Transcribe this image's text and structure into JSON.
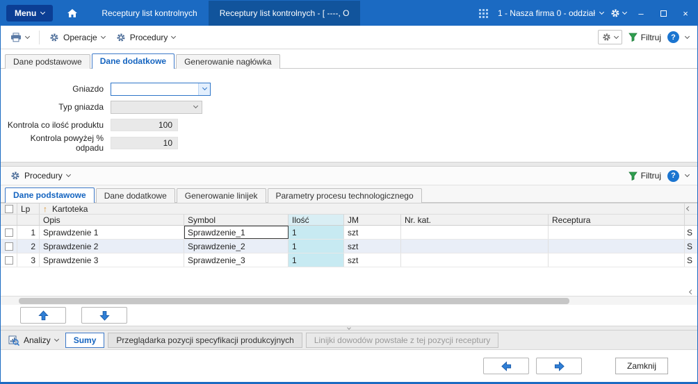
{
  "colors": {
    "titlebar_blue": "#1b6ac2",
    "menu_navy": "#0b3e94",
    "accent_blue": "#1464c0",
    "active_tab_border": "#3c78c8",
    "ilosc_cyan": "#c7eaf2",
    "row_alt_blue": "#e9eef7",
    "filter_green": "#2f9e4f"
  },
  "titlebar": {
    "menu_label": "Menu",
    "tab_background": "Receptury list kontrolnych",
    "tab_active": "Receptury list kontrolnych - [ ----, O",
    "company_selector": "1 - Nasza firma 0 - oddział",
    "minimize_glyph": "–",
    "close_glyph": "×"
  },
  "toolbar": {
    "operacje_label": "Operacje",
    "procedury_label": "Procedury",
    "filtruj_label": "Filtruj",
    "help_glyph": "?"
  },
  "upper_tabs": [
    {
      "label": "Dane podstawowe"
    },
    {
      "label": "Dane dodatkowe"
    },
    {
      "label": "Generowanie nagłówka"
    }
  ],
  "form": {
    "gniazdo_label": "Gniazdo",
    "gniazdo_value": "",
    "typ_gniazda_label": "Typ gniazda",
    "typ_gniazda_value": "",
    "kontrola_ilosc_label": "Kontrola co ilość produktu",
    "kontrola_ilosc_value": "100",
    "kontrola_odpad_label": "Kontrola powyżej % odpadu",
    "kontrola_odpad_value": "10"
  },
  "procedures_bar": {
    "label": "Procedury",
    "filtruj_label": "Filtruj",
    "help_glyph": "?"
  },
  "lower_tabs": [
    {
      "label": "Dane podstawowe"
    },
    {
      "label": "Dane dodatkowe"
    },
    {
      "label": "Generowanie linijek"
    },
    {
      "label": "Parametry procesu technologicznego"
    }
  ],
  "grid": {
    "sort_icon": "↑",
    "band": {
      "lp": "Lp",
      "group": "Kartoteka"
    },
    "columns": [
      "Opis",
      "Symbol",
      "Ilość",
      "JM",
      "Nr. kat.",
      "Receptura"
    ],
    "rows": [
      {
        "lp": "1",
        "opis": "Sprawdzenie 1",
        "symbol": "Sprawdzenie_1",
        "ilosc": "1",
        "jm": "szt",
        "nr_kat": "",
        "receptura": "",
        "cutoff": "S"
      },
      {
        "lp": "2",
        "opis": "Sprawdzenie 2",
        "symbol": "Sprawdzenie_2",
        "ilosc": "1",
        "jm": "szt",
        "nr_kat": "",
        "receptura": "",
        "cutoff": "S"
      },
      {
        "lp": "3",
        "opis": "Sprawdzenie 3",
        "symbol": "Sprawdzenie_3",
        "ilosc": "1",
        "jm": "szt",
        "nr_kat": "",
        "receptura": "",
        "cutoff": "S"
      }
    ]
  },
  "bottom_panel": {
    "analizy_label": "Analizy",
    "tabs": [
      {
        "label": "Sumy"
      },
      {
        "label": "Przeglądarka pozycji specyfikacji produkcyjnych"
      },
      {
        "label": "Linijki dowodów powstałe z  tej pozycji receptury"
      }
    ]
  },
  "footer": {
    "close_label": "Zamknij"
  }
}
